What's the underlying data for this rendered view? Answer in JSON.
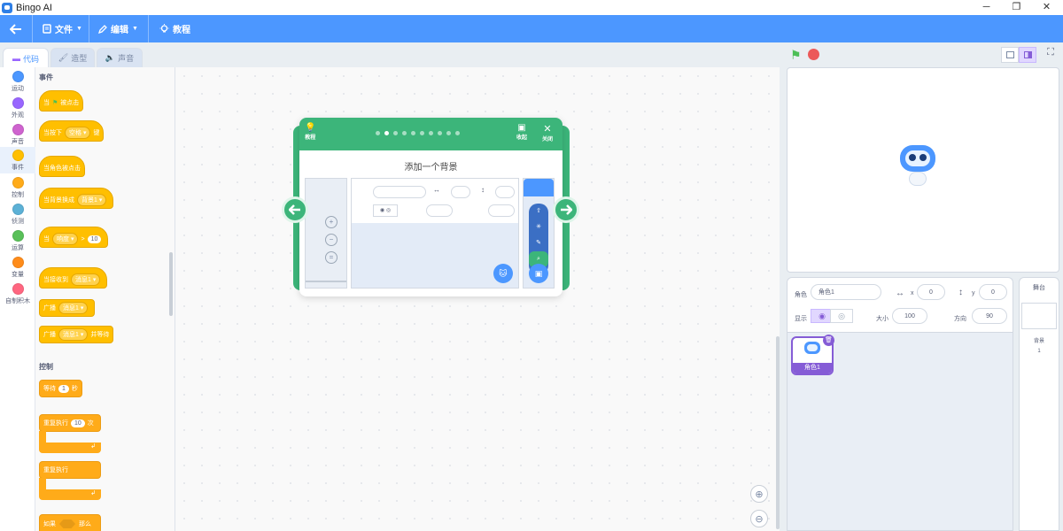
{
  "window": {
    "title": "Bingo AI",
    "controls": {
      "minimize": "─",
      "maximize": "❐",
      "close": "✕"
    }
  },
  "menubar": {
    "file": "文件",
    "edit": "编辑",
    "tutorial": "教程"
  },
  "tabs": {
    "code": "代码",
    "costumes": "造型",
    "sounds": "声音"
  },
  "categories": [
    {
      "label": "运动",
      "color": "#4c97ff"
    },
    {
      "label": "外观",
      "color": "#9966ff"
    },
    {
      "label": "声音",
      "color": "#cf63cf"
    },
    {
      "label": "事件",
      "color": "#ffbf00"
    },
    {
      "label": "控制",
      "color": "#ffab19"
    },
    {
      "label": "侦测",
      "color": "#5cb1d6"
    },
    {
      "label": "运算",
      "color": "#59c059"
    },
    {
      "label": "变量",
      "color": "#ff8c1a"
    },
    {
      "label": "自制积木",
      "color": "#ff6680"
    }
  ],
  "palette": {
    "events_title": "事件",
    "flag_clicked": {
      "pre": "当",
      "post": "被点击"
    },
    "key_pressed": {
      "pre": "当按下",
      "key": "空格",
      "post": "键"
    },
    "sprite_clicked": "当角色被点击",
    "backdrop_switch": {
      "pre": "当背景换成",
      "value": "背景1"
    },
    "greater_than": {
      "pre": "当",
      "sensor": "响度",
      "op": ">",
      "value": "10"
    },
    "receive": {
      "pre": "当接收到",
      "value": "消息1"
    },
    "broadcast": {
      "pre": "广播",
      "value": "消息1"
    },
    "broadcast_wait": {
      "pre": "广播",
      "value": "消息1",
      "post": "并等待"
    },
    "control_title": "控制",
    "wait": {
      "pre": "等待",
      "value": "1",
      "post": "秒"
    },
    "repeat": {
      "pre": "重复执行",
      "value": "10",
      "post": "次"
    },
    "forever": "重复执行",
    "if_then": {
      "pre": "如果",
      "post": "那么"
    }
  },
  "modal": {
    "tip_label": "教程",
    "collapse_label": "收起",
    "close_label": "关闭",
    "step_count": 10,
    "current_step": 2,
    "title": "添加一个背景"
  },
  "stage_controls": {
    "small": "small-stage-icon",
    "large": "large-stage-icon",
    "fullscreen": "fullscreen-icon"
  },
  "sprite_info": {
    "sprite_label": "角色",
    "sprite_name": "角色1",
    "x_label": "x",
    "x_value": "0",
    "y_label": "y",
    "y_value": "0",
    "show_label": "显示",
    "size_label": "大小",
    "size_value": "100",
    "direction_label": "方向",
    "direction_value": "90"
  },
  "sprites": [
    {
      "name": "角色1"
    }
  ],
  "stage_panel": {
    "title": "舞台",
    "backdrops_label": "背景",
    "backdrops_count": "1"
  }
}
